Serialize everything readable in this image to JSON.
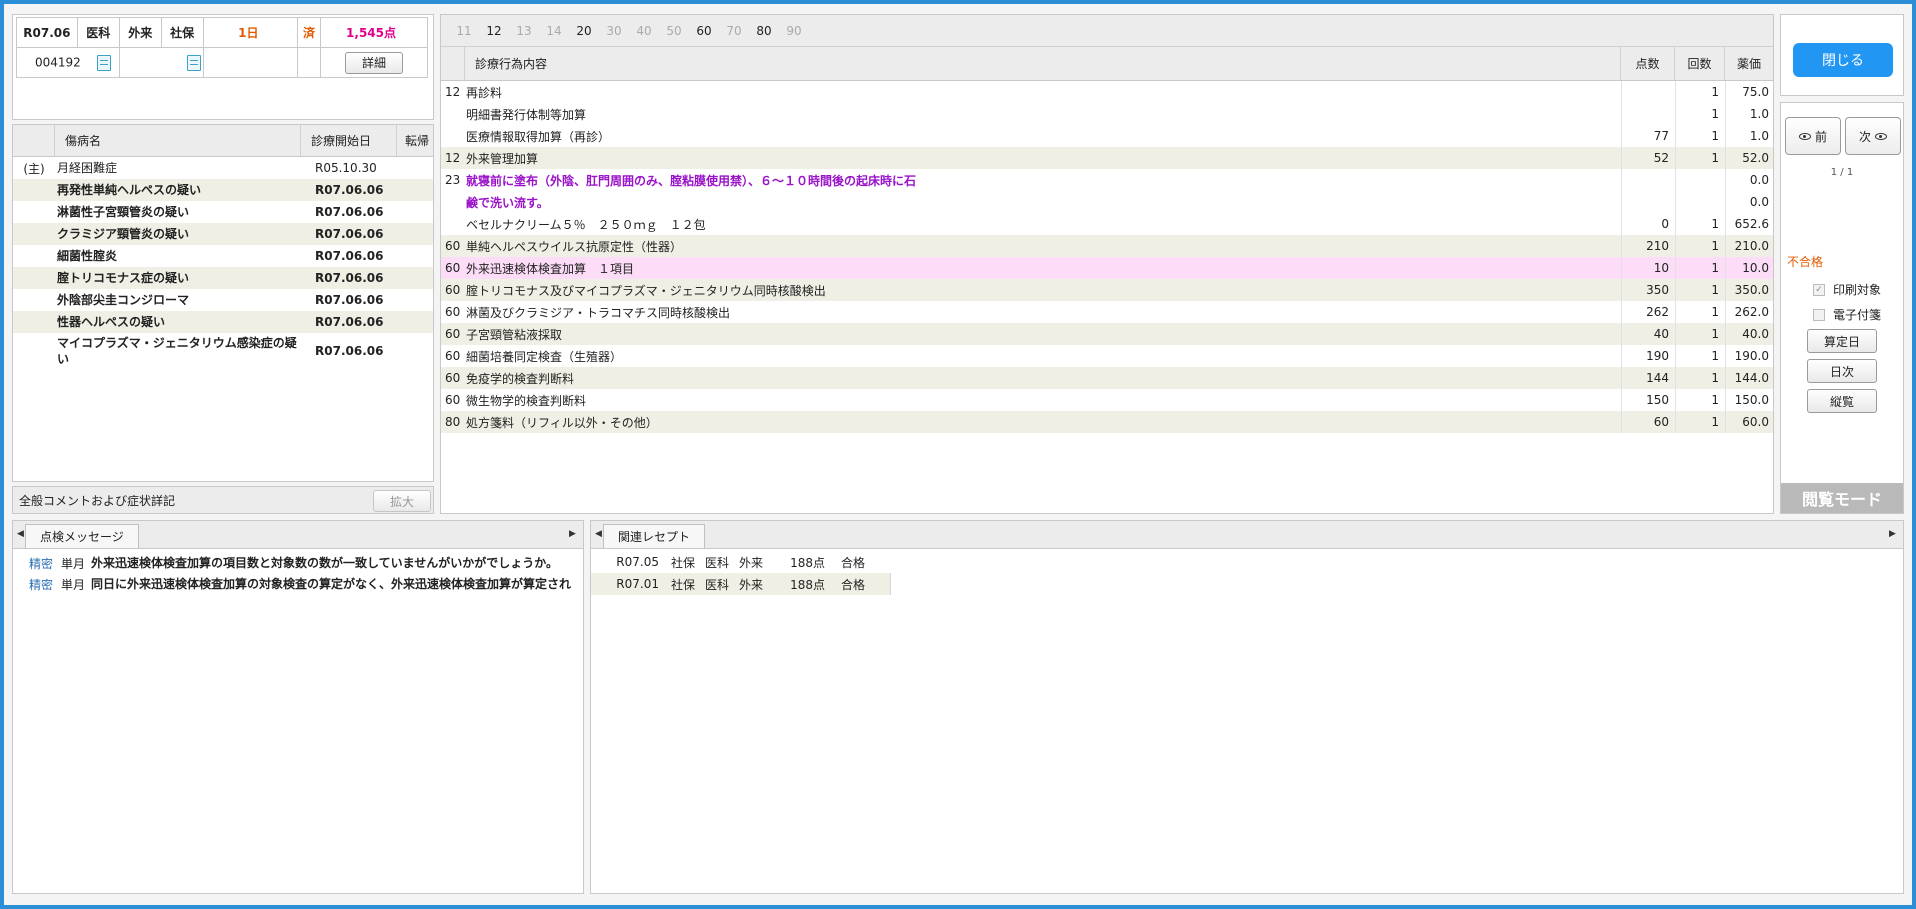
{
  "header": {
    "date": "R07.06",
    "dept": "医科",
    "visit": "外来",
    "insurance": "社保",
    "day_count": "1日",
    "done": "済",
    "points": "1,545点",
    "patient_id": "004192",
    "detail_button": "詳細"
  },
  "diseases": {
    "col_name": "傷病名",
    "col_start": "診療開始日",
    "col_outcome": "転帰",
    "rows": [
      {
        "mark": "(主)",
        "name": "月経困難症",
        "start": "R05.10.30",
        "bold": false
      },
      {
        "mark": "",
        "name": "再発性単純ヘルペスの疑い",
        "start": "R07.06.06",
        "bold": true
      },
      {
        "mark": "",
        "name": "淋菌性子宮頸管炎の疑い",
        "start": "R07.06.06",
        "bold": true
      },
      {
        "mark": "",
        "name": "クラミジア頸管炎の疑い",
        "start": "R07.06.06",
        "bold": true
      },
      {
        "mark": "",
        "name": "細菌性腟炎",
        "start": "R07.06.06",
        "bold": true
      },
      {
        "mark": "",
        "name": "腟トリコモナス症の疑い",
        "start": "R07.06.06",
        "bold": true
      },
      {
        "mark": "",
        "name": "外陰部尖圭コンジローマ",
        "start": "R07.06.06",
        "bold": true
      },
      {
        "mark": "",
        "name": "性器ヘルペスの疑い",
        "start": "R07.06.06",
        "bold": true
      },
      {
        "mark": "",
        "name": "マイコプラズマ・ジェニタリウム感染症の疑い",
        "start": "R07.06.06",
        "bold": true
      }
    ]
  },
  "comment": {
    "label": "全般コメントおよび症状詳記",
    "expand_button": "拡大"
  },
  "treatment": {
    "num_tabs": [
      {
        "label": "11",
        "on": false
      },
      {
        "label": "12",
        "on": true
      },
      {
        "label": "13",
        "on": false
      },
      {
        "label": "14",
        "on": false
      },
      {
        "label": "20",
        "on": true
      },
      {
        "label": "30",
        "on": false
      },
      {
        "label": "40",
        "on": false
      },
      {
        "label": "50",
        "on": false
      },
      {
        "label": "60",
        "on": true
      },
      {
        "label": "70",
        "on": false
      },
      {
        "label": "80",
        "on": true
      },
      {
        "label": "90",
        "on": false
      }
    ],
    "col_name": "診療行為内容",
    "col_points": "点数",
    "col_count": "回数",
    "col_price": "薬価",
    "rows": [
      {
        "code": "12",
        "name": "再診料",
        "pts": "",
        "cnt": "1",
        "prc": "75.0",
        "style": ""
      },
      {
        "code": "",
        "name": "明細書発行体制等加算",
        "pts": "",
        "cnt": "1",
        "prc": "1.0",
        "style": ""
      },
      {
        "code": "",
        "name": "医療情報取得加算（再診）",
        "pts": "77",
        "cnt": "1",
        "prc": "1.0",
        "style": ""
      },
      {
        "code": "12",
        "name": "外来管理加算",
        "pts": "52",
        "cnt": "1",
        "prc": "52.0",
        "style": "alt"
      },
      {
        "code": "23",
        "name": "就寝前に塗布（外陰、肛門周囲のみ、腟粘膜使用禁）、６～１０時間後の起床時に石",
        "pts": "",
        "cnt": "",
        "prc": "0.0",
        "style": "purple"
      },
      {
        "code": "",
        "name": "鹸で洗い流す。",
        "pts": "",
        "cnt": "",
        "prc": "0.0",
        "style": "purple"
      },
      {
        "code": "",
        "name": "ベセルナクリーム５％　２５０ｍｇ　１２包",
        "pts": "0",
        "cnt": "1",
        "prc": "652.6",
        "style": ""
      },
      {
        "code": "60",
        "name": "単純ヘルペスウイルス抗原定性（性器）",
        "pts": "210",
        "cnt": "1",
        "prc": "210.0",
        "style": "alt"
      },
      {
        "code": "60",
        "name": "外来迅速検体検査加算　１項目",
        "pts": "10",
        "cnt": "1",
        "prc": "10.0",
        "style": "pink"
      },
      {
        "code": "60",
        "name": "腟トリコモナス及びマイコプラズマ・ジェニタリウム同時核酸検出",
        "pts": "350",
        "cnt": "1",
        "prc": "350.0",
        "style": "alt"
      },
      {
        "code": "60",
        "name": "淋菌及びクラミジア・トラコマチス同時核酸検出",
        "pts": "262",
        "cnt": "1",
        "prc": "262.0",
        "style": ""
      },
      {
        "code": "60",
        "name": "子宮頸管粘液採取",
        "pts": "40",
        "cnt": "1",
        "prc": "40.0",
        "style": "alt"
      },
      {
        "code": "60",
        "name": "細菌培養同定検査（生殖器）",
        "pts": "190",
        "cnt": "1",
        "prc": "190.0",
        "style": ""
      },
      {
        "code": "60",
        "name": "免疫学的検査判断料",
        "pts": "144",
        "cnt": "1",
        "prc": "144.0",
        "style": "alt"
      },
      {
        "code": "60",
        "name": "微生物学的検査判断料",
        "pts": "150",
        "cnt": "1",
        "prc": "150.0",
        "style": ""
      },
      {
        "code": "80",
        "name": "処方箋料（リフィル以外・その他）",
        "pts": "60",
        "cnt": "1",
        "prc": "60.0",
        "style": "alt"
      }
    ]
  },
  "side": {
    "close_button": "閉じる",
    "prev_button": "前",
    "next_button": "次",
    "page": "1 / 1",
    "status": "不合格",
    "status_color": "#e25b00",
    "print_target": "印刷対象",
    "e_note": "電子付箋",
    "calc_day_button": "算定日",
    "daily_button": "日次",
    "vertical_button": "縦覧",
    "mode": "閲覧モード"
  },
  "messages": {
    "tab": "点検メッセージ",
    "rows": [
      {
        "kind": "精密",
        "term": "単月",
        "text": "外来迅速検体検査加算の項目数と対象数の数が一致していませんがいかがでしょうか。"
      },
      {
        "kind": "精密",
        "term": "単月",
        "text": "同日に外来迅速検体検査加算の対象検査の算定がなく、外来迅速検体検査加算が算定され"
      }
    ]
  },
  "related": {
    "tab": "関連レセプト",
    "rows": [
      {
        "date": "R07.05",
        "ins": "社保",
        "dept": "医科",
        "visit": "外来",
        "pts": "188点",
        "result": "合格"
      },
      {
        "date": "R07.01",
        "ins": "社保",
        "dept": "医科",
        "visit": "外来",
        "pts": "188点",
        "result": "合格"
      }
    ]
  }
}
